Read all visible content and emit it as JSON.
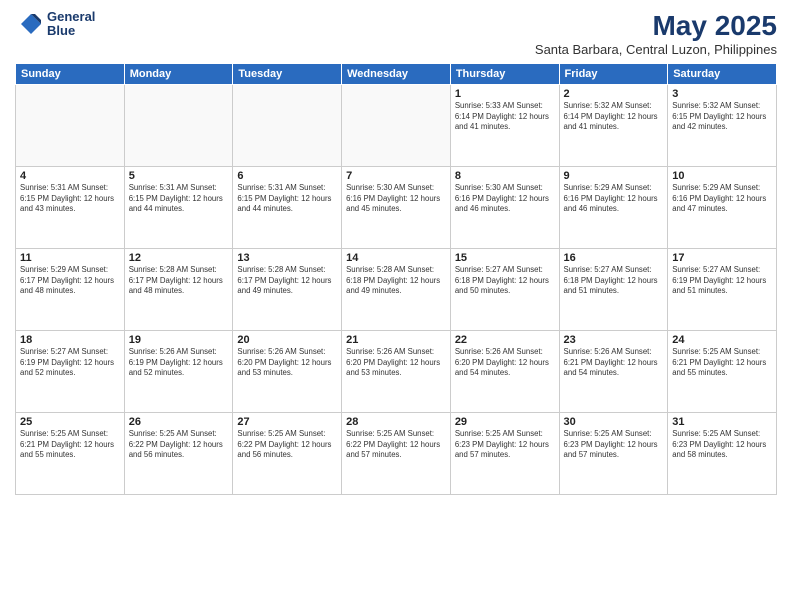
{
  "header": {
    "logo_line1": "General",
    "logo_line2": "Blue",
    "title": "May 2025",
    "subtitle": "Santa Barbara, Central Luzon, Philippines"
  },
  "days_of_week": [
    "Sunday",
    "Monday",
    "Tuesday",
    "Wednesday",
    "Thursday",
    "Friday",
    "Saturday"
  ],
  "weeks": [
    [
      {
        "day": "",
        "info": ""
      },
      {
        "day": "",
        "info": ""
      },
      {
        "day": "",
        "info": ""
      },
      {
        "day": "",
        "info": ""
      },
      {
        "day": "1",
        "info": "Sunrise: 5:33 AM\nSunset: 6:14 PM\nDaylight: 12 hours\nand 41 minutes."
      },
      {
        "day": "2",
        "info": "Sunrise: 5:32 AM\nSunset: 6:14 PM\nDaylight: 12 hours\nand 41 minutes."
      },
      {
        "day": "3",
        "info": "Sunrise: 5:32 AM\nSunset: 6:15 PM\nDaylight: 12 hours\nand 42 minutes."
      }
    ],
    [
      {
        "day": "4",
        "info": "Sunrise: 5:31 AM\nSunset: 6:15 PM\nDaylight: 12 hours\nand 43 minutes."
      },
      {
        "day": "5",
        "info": "Sunrise: 5:31 AM\nSunset: 6:15 PM\nDaylight: 12 hours\nand 44 minutes."
      },
      {
        "day": "6",
        "info": "Sunrise: 5:31 AM\nSunset: 6:15 PM\nDaylight: 12 hours\nand 44 minutes."
      },
      {
        "day": "7",
        "info": "Sunrise: 5:30 AM\nSunset: 6:16 PM\nDaylight: 12 hours\nand 45 minutes."
      },
      {
        "day": "8",
        "info": "Sunrise: 5:30 AM\nSunset: 6:16 PM\nDaylight: 12 hours\nand 46 minutes."
      },
      {
        "day": "9",
        "info": "Sunrise: 5:29 AM\nSunset: 6:16 PM\nDaylight: 12 hours\nand 46 minutes."
      },
      {
        "day": "10",
        "info": "Sunrise: 5:29 AM\nSunset: 6:16 PM\nDaylight: 12 hours\nand 47 minutes."
      }
    ],
    [
      {
        "day": "11",
        "info": "Sunrise: 5:29 AM\nSunset: 6:17 PM\nDaylight: 12 hours\nand 48 minutes."
      },
      {
        "day": "12",
        "info": "Sunrise: 5:28 AM\nSunset: 6:17 PM\nDaylight: 12 hours\nand 48 minutes."
      },
      {
        "day": "13",
        "info": "Sunrise: 5:28 AM\nSunset: 6:17 PM\nDaylight: 12 hours\nand 49 minutes."
      },
      {
        "day": "14",
        "info": "Sunrise: 5:28 AM\nSunset: 6:18 PM\nDaylight: 12 hours\nand 49 minutes."
      },
      {
        "day": "15",
        "info": "Sunrise: 5:27 AM\nSunset: 6:18 PM\nDaylight: 12 hours\nand 50 minutes."
      },
      {
        "day": "16",
        "info": "Sunrise: 5:27 AM\nSunset: 6:18 PM\nDaylight: 12 hours\nand 51 minutes."
      },
      {
        "day": "17",
        "info": "Sunrise: 5:27 AM\nSunset: 6:19 PM\nDaylight: 12 hours\nand 51 minutes."
      }
    ],
    [
      {
        "day": "18",
        "info": "Sunrise: 5:27 AM\nSunset: 6:19 PM\nDaylight: 12 hours\nand 52 minutes."
      },
      {
        "day": "19",
        "info": "Sunrise: 5:26 AM\nSunset: 6:19 PM\nDaylight: 12 hours\nand 52 minutes."
      },
      {
        "day": "20",
        "info": "Sunrise: 5:26 AM\nSunset: 6:20 PM\nDaylight: 12 hours\nand 53 minutes."
      },
      {
        "day": "21",
        "info": "Sunrise: 5:26 AM\nSunset: 6:20 PM\nDaylight: 12 hours\nand 53 minutes."
      },
      {
        "day": "22",
        "info": "Sunrise: 5:26 AM\nSunset: 6:20 PM\nDaylight: 12 hours\nand 54 minutes."
      },
      {
        "day": "23",
        "info": "Sunrise: 5:26 AM\nSunset: 6:21 PM\nDaylight: 12 hours\nand 54 minutes."
      },
      {
        "day": "24",
        "info": "Sunrise: 5:25 AM\nSunset: 6:21 PM\nDaylight: 12 hours\nand 55 minutes."
      }
    ],
    [
      {
        "day": "25",
        "info": "Sunrise: 5:25 AM\nSunset: 6:21 PM\nDaylight: 12 hours\nand 55 minutes."
      },
      {
        "day": "26",
        "info": "Sunrise: 5:25 AM\nSunset: 6:22 PM\nDaylight: 12 hours\nand 56 minutes."
      },
      {
        "day": "27",
        "info": "Sunrise: 5:25 AM\nSunset: 6:22 PM\nDaylight: 12 hours\nand 56 minutes."
      },
      {
        "day": "28",
        "info": "Sunrise: 5:25 AM\nSunset: 6:22 PM\nDaylight: 12 hours\nand 57 minutes."
      },
      {
        "day": "29",
        "info": "Sunrise: 5:25 AM\nSunset: 6:23 PM\nDaylight: 12 hours\nand 57 minutes."
      },
      {
        "day": "30",
        "info": "Sunrise: 5:25 AM\nSunset: 6:23 PM\nDaylight: 12 hours\nand 57 minutes."
      },
      {
        "day": "31",
        "info": "Sunrise: 5:25 AM\nSunset: 6:23 PM\nDaylight: 12 hours\nand 58 minutes."
      }
    ]
  ]
}
